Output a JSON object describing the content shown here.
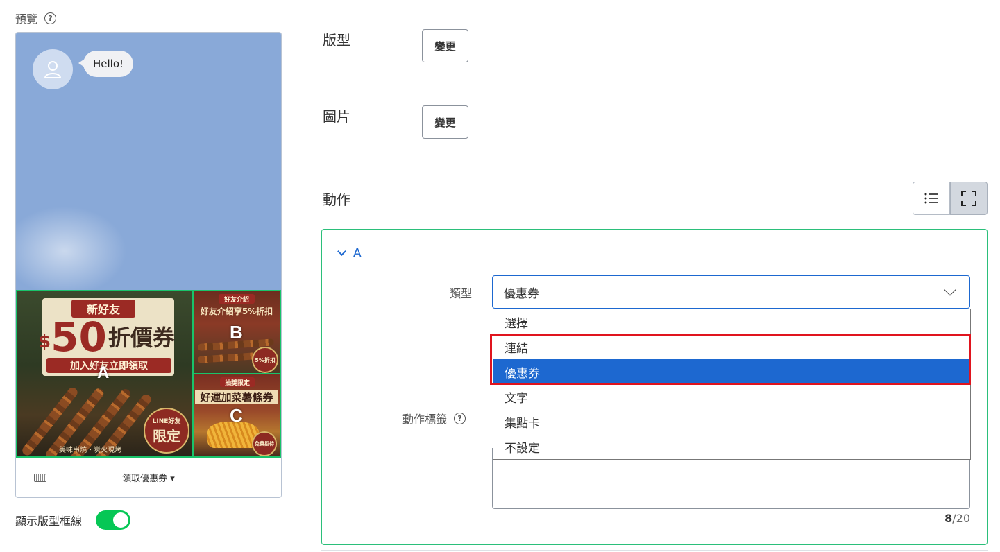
{
  "preview": {
    "title": "預覽",
    "help_symbol": "?",
    "chat": {
      "greeting": "Hello!"
    },
    "rich_menu": {
      "cells": [
        {
          "letter": "A",
          "headline": "新好友",
          "amount_prefix": "$",
          "amount": "50",
          "amount_suffix": "折價券",
          "ribbon": "加入好友立即領取",
          "badge_top": "LINE好友",
          "badge_main": "限定",
          "footer": "美味串燒・炭火現烤"
        },
        {
          "letter": "B",
          "tag": "好友介紹",
          "headline": "好友介紹享5%折扣",
          "badge": "5%折扣"
        },
        {
          "letter": "C",
          "tag": "抽獎限定",
          "headline": "好運加菜薯條券",
          "badge": "免費招待"
        }
      ]
    },
    "menu_bar_label": "領取優惠券 ▾",
    "show_frame_label": "顯示版型框線",
    "show_frame_on": true
  },
  "form": {
    "layout": {
      "label": "版型",
      "button": "變更"
    },
    "image": {
      "label": "圖片",
      "button": "變更"
    },
    "action": {
      "label": "動作"
    },
    "action_card": {
      "title": "A",
      "type_label": "類型",
      "type_value": "優惠券",
      "action_label_label": "動作標籤",
      "help_symbol": "?",
      "counter_current": "8",
      "counter_max": "/20",
      "dropdown_options": [
        "選擇",
        "連結",
        "優惠券",
        "文字",
        "集點卡",
        "不設定"
      ],
      "dropdown_selected": "優惠券"
    }
  },
  "colors": {
    "accent_blue": "#1d68d0",
    "line_green": "#06c755",
    "frame_green": "#19c36a",
    "highlight_red": "#e0141e"
  }
}
